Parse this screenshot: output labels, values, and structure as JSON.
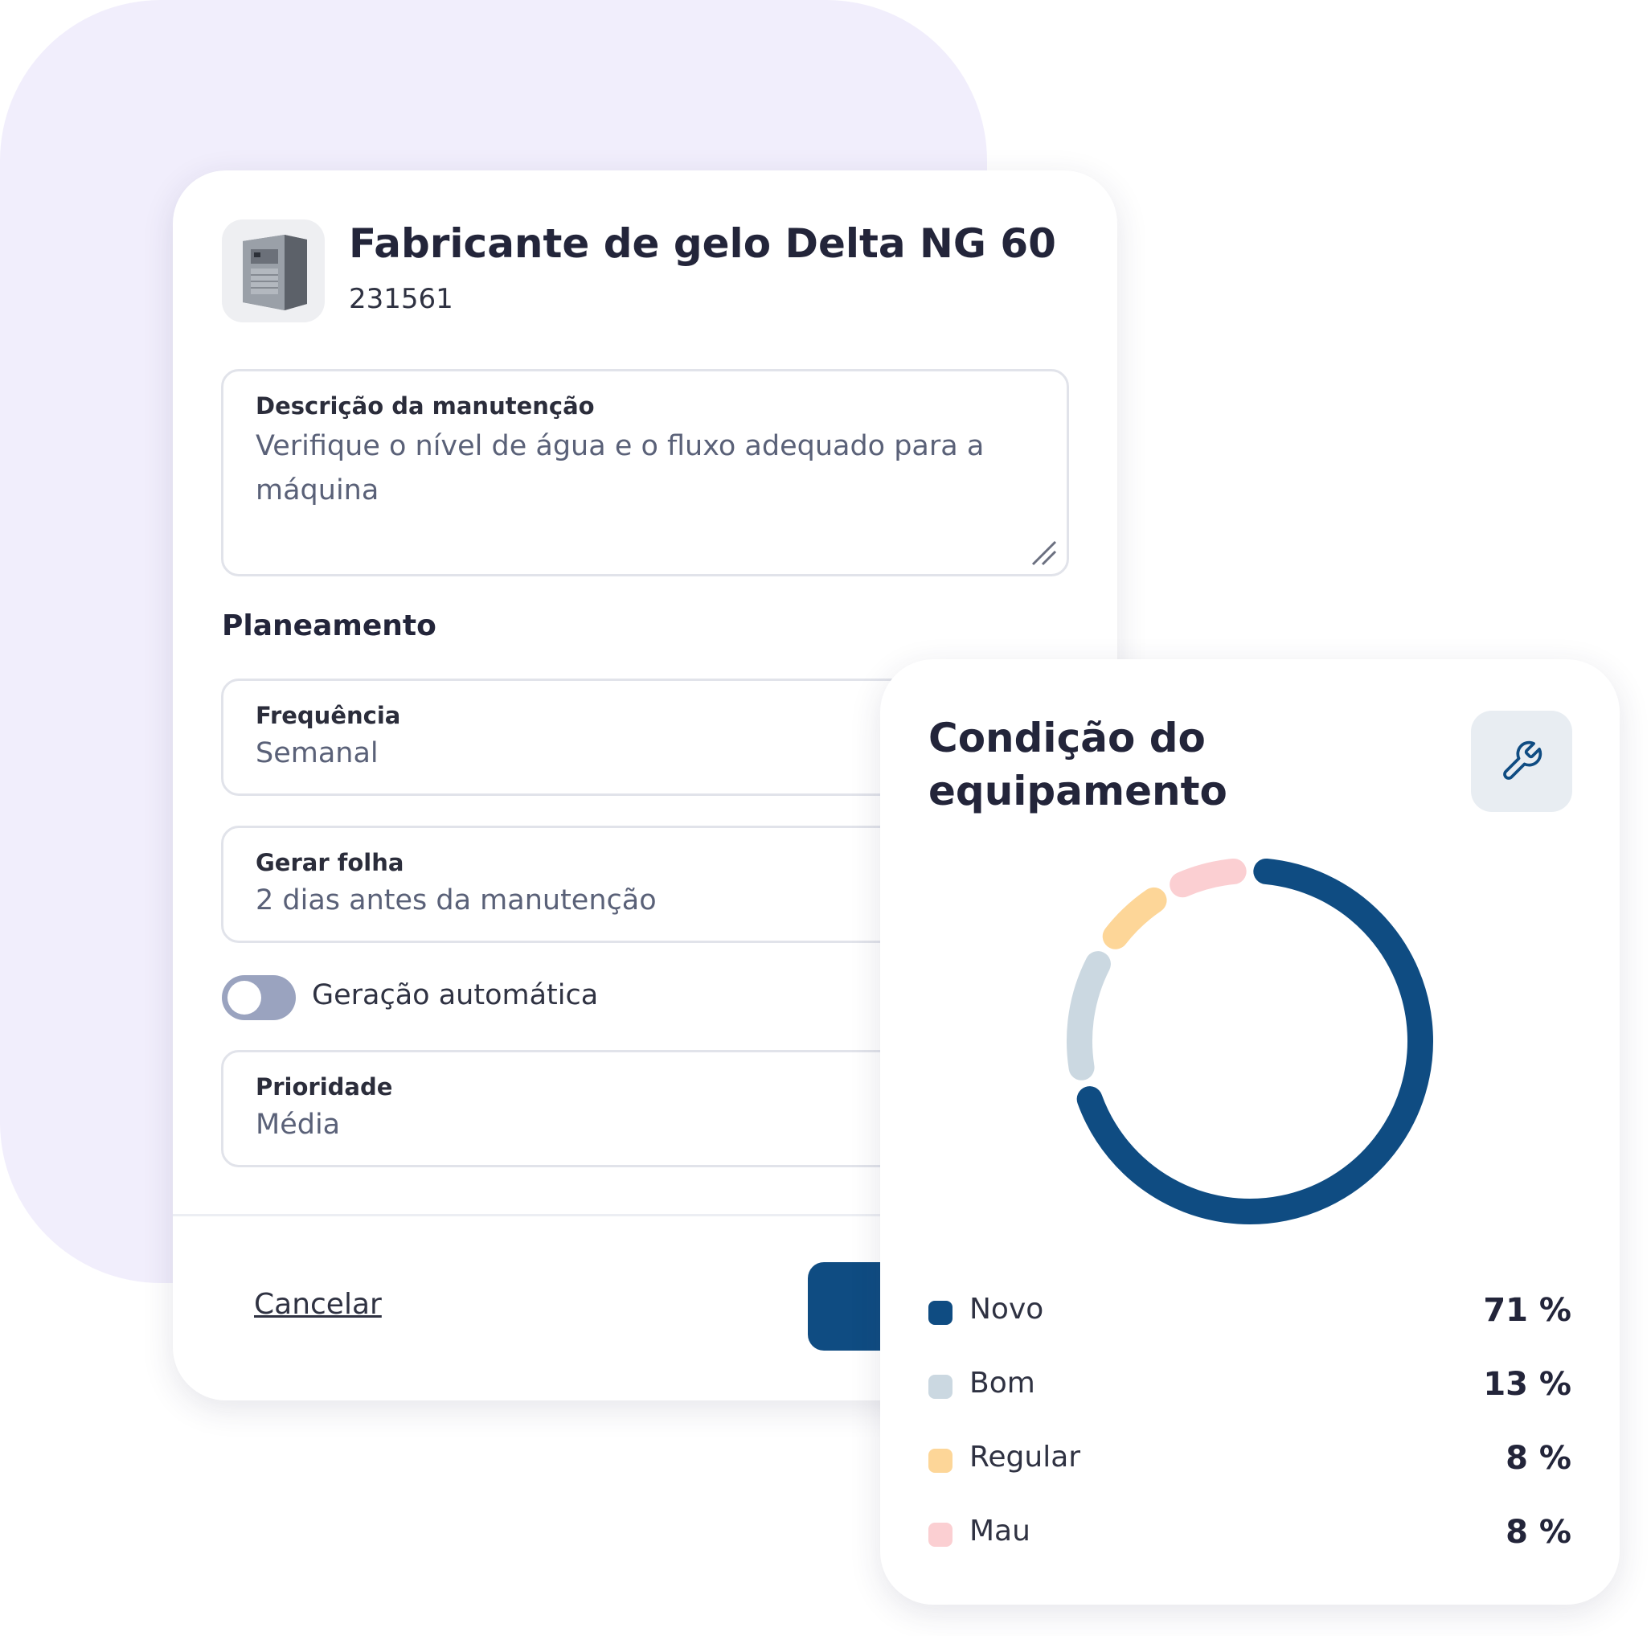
{
  "asset": {
    "title": "Fabricante de gelo Delta NG 60",
    "id": "231561",
    "image_icon": "ice-machine-photo"
  },
  "description": {
    "label": "Descrição da manutenção",
    "value": "Verifique o nível de água e o fluxo adequado para a máquina"
  },
  "planning": {
    "title": "Planeamento",
    "frequency": {
      "label": "Frequência",
      "value": "Semanal"
    },
    "generate": {
      "label": "Gerar folha",
      "value": "2 dias antes da manutenção"
    },
    "auto_toggle": {
      "label": "Geração automática",
      "on": false
    },
    "priority": {
      "label": "Prioridade",
      "value": "Média"
    }
  },
  "footer": {
    "cancel_label": "Cancelar"
  },
  "condition": {
    "title": "Condição do equipamento",
    "tool_icon": "wrench-icon",
    "legend": [
      {
        "name": "Novo",
        "pct": "71 %",
        "value": 71,
        "color": "#0f4c82"
      },
      {
        "name": "Bom",
        "pct": "13 %",
        "value": 13,
        "color": "#cbd8e1"
      },
      {
        "name": "Regular",
        "pct": "8 %",
        "value": 8,
        "color": "#fdd698"
      },
      {
        "name": "Mau",
        "pct": "8 %",
        "value": 8,
        "color": "#fbcfd2"
      }
    ]
  }
}
